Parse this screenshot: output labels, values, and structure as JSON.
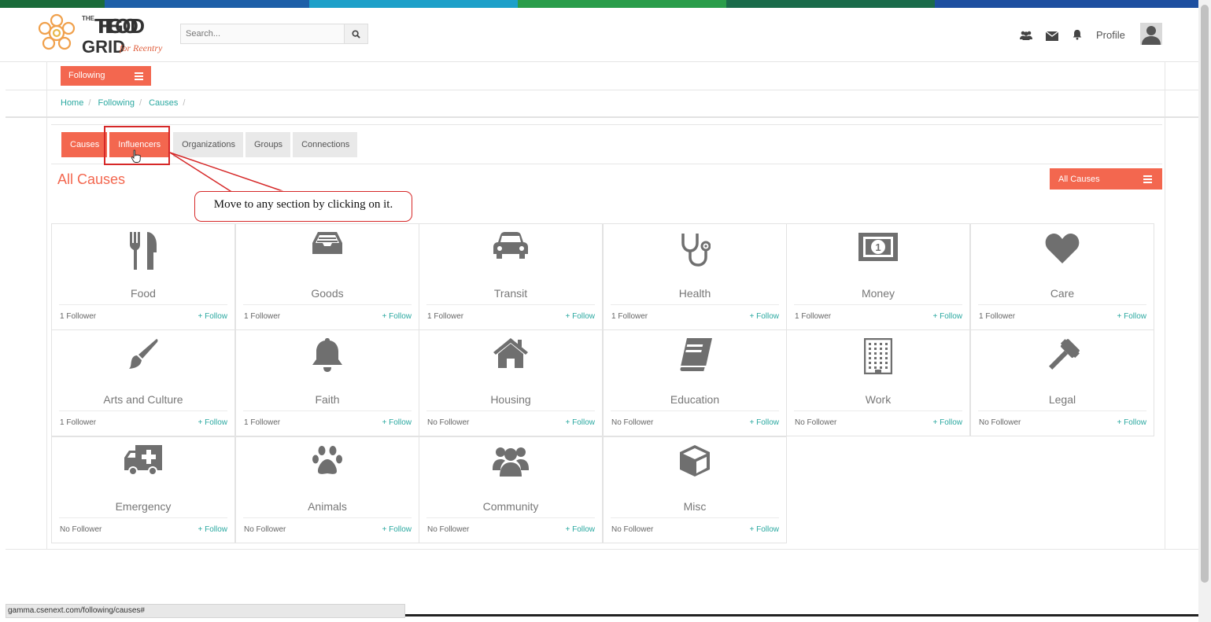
{
  "colors": {
    "accent": "#f3674f",
    "link": "#2aa8a0",
    "annotation": "#d62828",
    "stripe": [
      "#1a6b3a",
      "#1d5fa8",
      "#1da0c9",
      "#2a9d4a",
      "#1a6b4a",
      "#1d4fa0"
    ]
  },
  "header": {
    "logo_text_top": "THE GOOD",
    "logo_text_bottom": "GRID",
    "logo_tagline": "for Reentry",
    "search_placeholder": "Search...",
    "icons": [
      "users-icon",
      "envelope-icon",
      "bell-icon"
    ],
    "profile_label": "Profile"
  },
  "following_menu": {
    "label": "Following"
  },
  "breadcrumb": [
    "Home",
    "Following",
    "Causes"
  ],
  "tabs": [
    {
      "label": "Causes",
      "active": true
    },
    {
      "label": "Influencers",
      "active": true
    },
    {
      "label": "Organizations",
      "active": false
    },
    {
      "label": "Groups",
      "active": false
    },
    {
      "label": "Connections",
      "active": false
    }
  ],
  "section_title": "All Causes",
  "filter_button": "All Causes",
  "annotation": {
    "callout_text": "Move to any section by clicking on it."
  },
  "causes": [
    {
      "name": "Food",
      "followers": "1 Follower",
      "follow": "+ Follow",
      "icon": "utensils-icon"
    },
    {
      "name": "Goods",
      "followers": "1 Follower",
      "follow": "+ Follow",
      "icon": "inbox-icon"
    },
    {
      "name": "Transit",
      "followers": "1 Follower",
      "follow": "+ Follow",
      "icon": "car-icon"
    },
    {
      "name": "Health",
      "followers": "1 Follower",
      "follow": "+ Follow",
      "icon": "stethoscope-icon"
    },
    {
      "name": "Money",
      "followers": "1 Follower",
      "follow": "+ Follow",
      "icon": "money-icon"
    },
    {
      "name": "Care",
      "followers": "1 Follower",
      "follow": "+ Follow",
      "icon": "heart-icon"
    },
    {
      "name": "Arts and Culture",
      "followers": "1 Follower",
      "follow": "+ Follow",
      "icon": "paintbrush-icon"
    },
    {
      "name": "Faith",
      "followers": "1 Follower",
      "follow": "+ Follow",
      "icon": "bell-icon"
    },
    {
      "name": "Housing",
      "followers": "No Follower",
      "follow": "+ Follow",
      "icon": "home-icon"
    },
    {
      "name": "Education",
      "followers": "No Follower",
      "follow": "+ Follow",
      "icon": "book-icon"
    },
    {
      "name": "Work",
      "followers": "No Follower",
      "follow": "+ Follow",
      "icon": "building-icon"
    },
    {
      "name": "Legal",
      "followers": "No Follower",
      "follow": "+ Follow",
      "icon": "gavel-icon"
    },
    {
      "name": "Emergency",
      "followers": "No Follower",
      "follow": "+ Follow",
      "icon": "ambulance-icon"
    },
    {
      "name": "Animals",
      "followers": "No Follower",
      "follow": "+ Follow",
      "icon": "paw-icon"
    },
    {
      "name": "Community",
      "followers": "No Follower",
      "follow": "+ Follow",
      "icon": "users-icon"
    },
    {
      "name": "Misc",
      "followers": "No Follower",
      "follow": "+ Follow",
      "icon": "cube-icon"
    }
  ],
  "status_bar_url": "gamma.csenext.com/following/causes#"
}
